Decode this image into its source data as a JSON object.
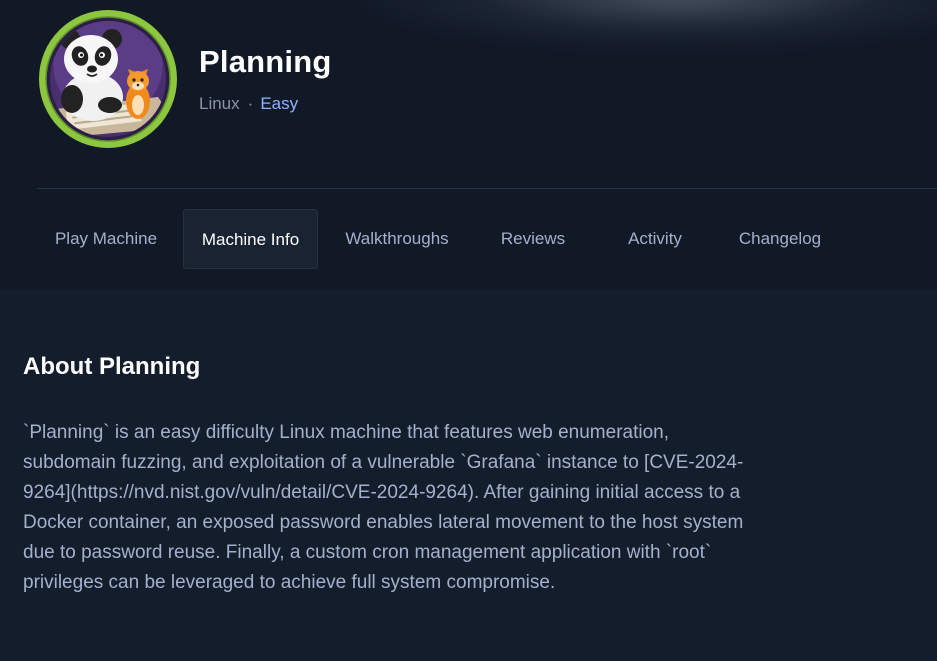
{
  "machine": {
    "name": "Planning",
    "os": "Linux",
    "separator": "·",
    "difficulty": "Easy"
  },
  "tabs": [
    {
      "label": "Play Machine"
    },
    {
      "label": "Machine Info",
      "active": true
    },
    {
      "label": "Walkthroughs"
    },
    {
      "label": "Reviews"
    },
    {
      "label": "Activity"
    },
    {
      "label": "Changelog"
    }
  ],
  "about": {
    "title": "About Planning",
    "text": "`Planning` is an easy difficulty Linux machine that features web enumeration, subdomain fuzzing, and exploitation of a vulnerable `Grafana` instance to [CVE-2024-9264](https://nvd.nist.gov/vuln/detail/CVE-2024-9264). After gaining initial access to a Docker container, an exposed password enables lateral movement to the host system due to password reuse. Finally, a custom cron management application with `root` privileges can be leveraged to achieve full system compromise."
  },
  "colors": {
    "background": "#141d2b",
    "header": "#111927",
    "difficulty_easy": "#8fb2ff",
    "avatar_ring": "#8dc63f",
    "text_muted": "#a4b1cd"
  },
  "icons": {
    "avatar": "panda-and-fox-avatar-icon"
  }
}
